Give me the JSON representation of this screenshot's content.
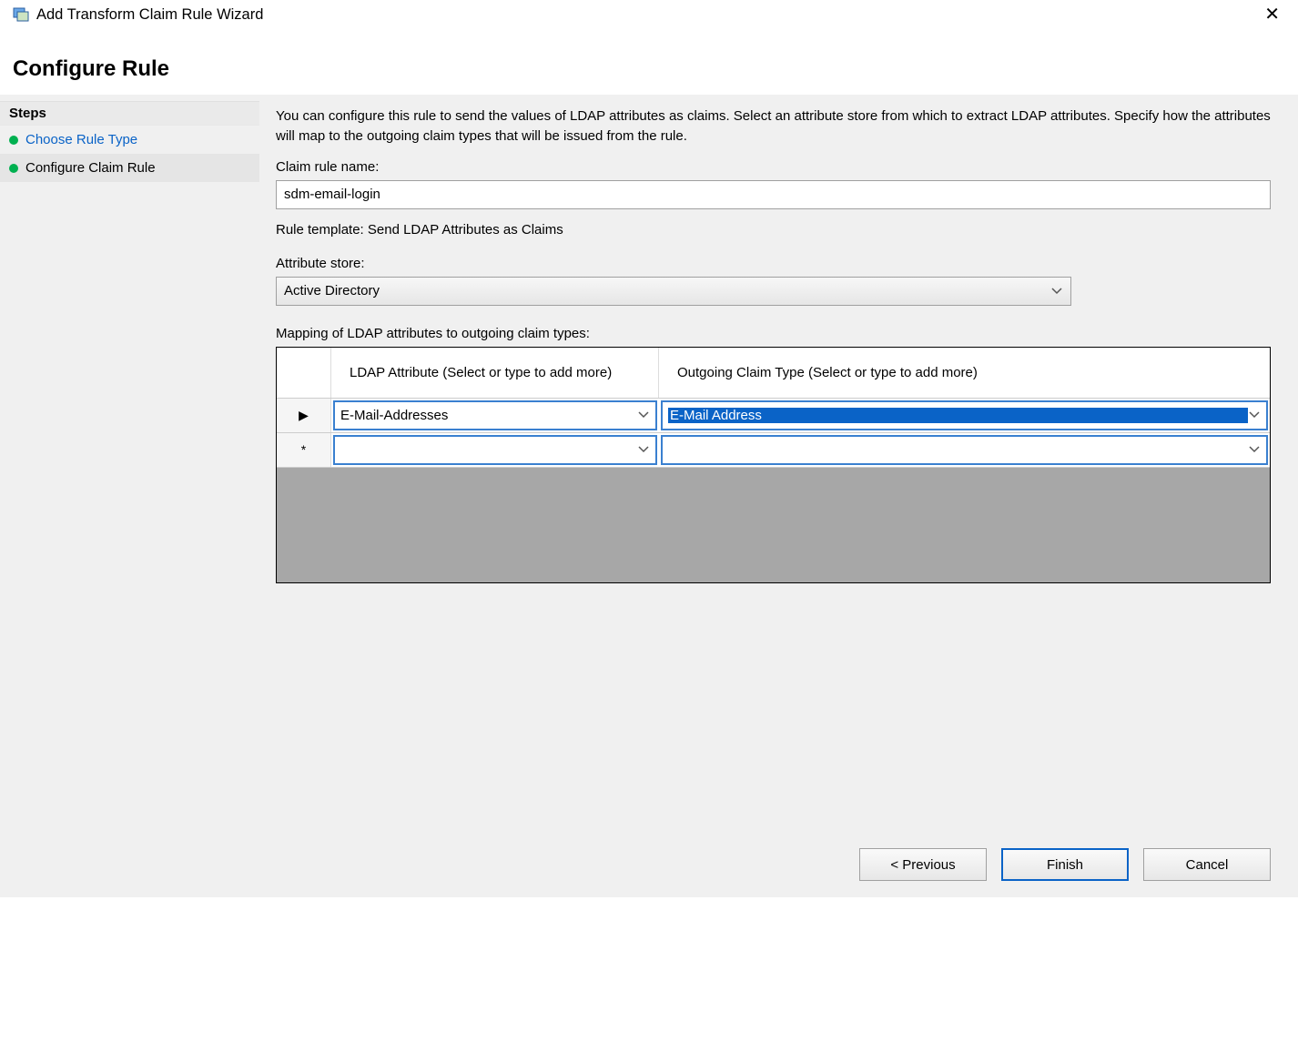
{
  "window": {
    "title": "Add Transform Claim Rule Wizard"
  },
  "page": {
    "title": "Configure Rule"
  },
  "sidebar": {
    "header": "Steps",
    "items": [
      {
        "label": "Choose Rule Type",
        "link": true
      },
      {
        "label": "Configure Claim Rule",
        "link": false
      }
    ]
  },
  "description": "You can configure this rule to send the values of LDAP attributes as claims. Select an attribute store from which to extract LDAP attributes. Specify how the attributes will map to the outgoing claim types that will be issued from the rule.",
  "claim_rule_name": {
    "label": "Claim rule name:",
    "value": "sdm-email-login"
  },
  "rule_template_text": "Rule template: Send LDAP Attributes as Claims",
  "attribute_store": {
    "label": "Attribute store:",
    "value": "Active Directory"
  },
  "mapping": {
    "label": "Mapping of LDAP attributes to outgoing claim types:",
    "headers": {
      "ldap": "LDAP Attribute (Select or type to add more)",
      "outgoing": "Outgoing Claim Type (Select or type to add more)"
    },
    "rows": [
      {
        "indicator": "▶",
        "ldap": "E-Mail-Addresses",
        "outgoing": "E-Mail Address",
        "selected": true
      },
      {
        "indicator": "*",
        "ldap": "",
        "outgoing": "",
        "selected": false
      }
    ]
  },
  "buttons": {
    "previous": "< Previous",
    "finish": "Finish",
    "cancel": "Cancel"
  }
}
